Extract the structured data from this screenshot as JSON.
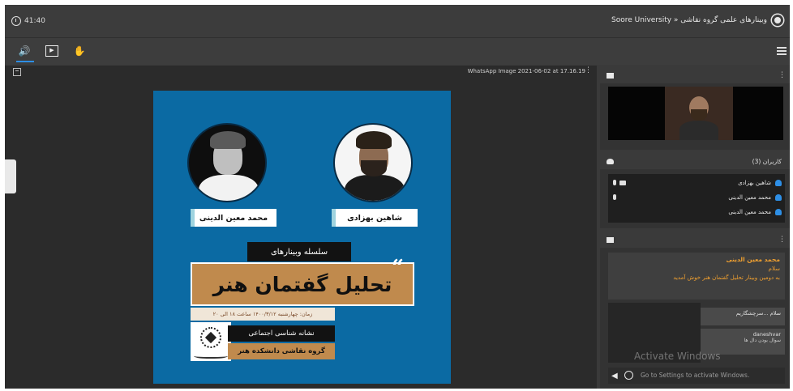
{
  "topbar": {
    "clock": "41:40",
    "title": "Soore University » وبینارهای علمی گروه نقاشی"
  },
  "toolbar": {
    "audio_icon": "speaker-icon",
    "share_icon": "screen-share-icon",
    "raise_hand_icon": "raise-hand-icon",
    "menu_icon": "hamburger-icon"
  },
  "presentation": {
    "file_name": "WhatsApp Image 2021-06-02 at 17.16.19",
    "poster": {
      "speaker_left": "محمد معین الدینی",
      "speaker_right": "شاهین بهزادی",
      "series": "سلسله وبینارهای",
      "title": "تحلیل گفتمان هنر",
      "date_line": "زمان: چهارشنبه ۱۴۰۰/۳/۱۲ ساعت ۱۸ الی ۲۰",
      "department": "نشانه شناسی اجتماعی",
      "group": "گروه نقاشی دانشکده هنر",
      "quote_mark": "“"
    }
  },
  "users": {
    "title": "کاربران (3)",
    "list": [
      "شاهین بهزادی",
      "محمد معین الدینی",
      "محمد معین الدینی"
    ]
  },
  "chat": {
    "sender": "محمد معین الدینی",
    "lines": [
      "سلام",
      "به دومین وبینار تحلیل گفتمان هنر خوش آمدید"
    ],
    "bubbles": [
      {
        "text": "سلام ...سرچشگاریم",
        "sub": ""
      },
      {
        "text": "daneshvar",
        "sub": "سوال بودن دال ها"
      }
    ],
    "placeholder": "Go to Settings to activate Windows."
  },
  "watermark": {
    "title": "Activate Windows",
    "subtitle": "Go to Settings to activate Windows."
  },
  "colors": {
    "poster_blue": "#0b6aa3",
    "accent_gold": "#c08a4d",
    "chat_orange": "#f0a030",
    "active_blue": "#2e8fe6"
  }
}
